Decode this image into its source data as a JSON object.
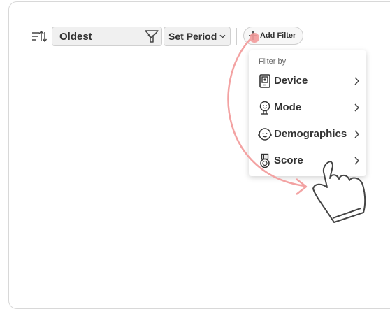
{
  "toolbar": {
    "sort_value": "Oldest",
    "period_label": "Set Period",
    "add_filter_label": "Add Filter"
  },
  "filter_menu": {
    "header": "Filter by",
    "items": [
      {
        "label": "Device",
        "icon": "device-icon"
      },
      {
        "label": "Mode",
        "icon": "mode-icon"
      },
      {
        "label": "Demographics",
        "icon": "face-icon"
      },
      {
        "label": "Score",
        "icon": "medal-icon"
      }
    ]
  },
  "colors": {
    "accent": "#f29a9a",
    "border": "#d8d8d8",
    "select_bg": "#f0f0f0"
  }
}
